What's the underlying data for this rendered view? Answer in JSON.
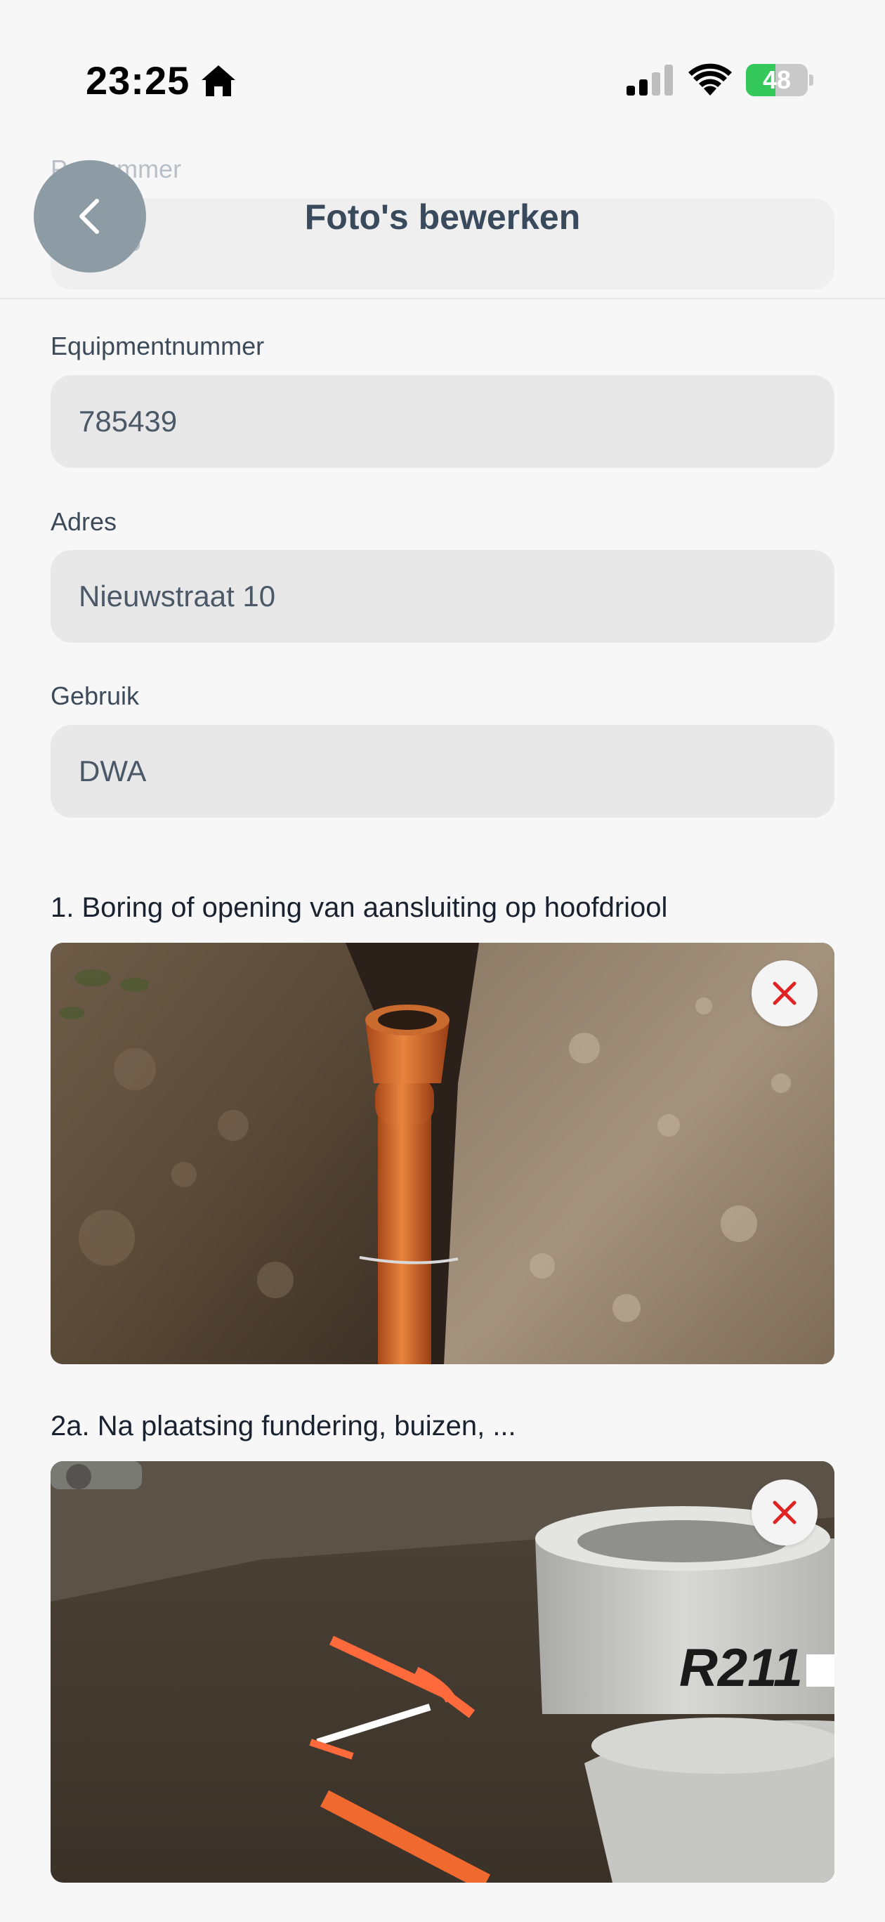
{
  "status_bar": {
    "time": "23:25",
    "battery": "48",
    "battery_level": 0.48,
    "icons": [
      "home-icon",
      "cellular-signal-icon",
      "wifi-icon",
      "battery-charging-icon"
    ]
  },
  "header": {
    "title": "Foto's bewerken",
    "ghost_label": "Putnummer",
    "ghost_value": "1075",
    "back_icon": "chevron-left-icon"
  },
  "form": {
    "equipment": {
      "label": "Equipmentnummer",
      "value": "785439"
    },
    "address": {
      "label": "Adres",
      "value": "Nieuwstraat 10"
    },
    "usage": {
      "label": "Gebruik",
      "value": "DWA"
    }
  },
  "photos": [
    {
      "label": "1. Boring of opening van aansluiting op hoofdriool",
      "remove_icon": "close-icon"
    },
    {
      "label": "2a. Na plaatsing fundering, buizen, ...",
      "remove_icon": "close-icon",
      "text_on_photo": "R211"
    }
  ],
  "colors": {
    "title": "#384a5c",
    "back_button": "#8d9ba4",
    "field_background": "#e8e8e8",
    "remove_icon": "#e02424",
    "battery_fill": "#34c759"
  }
}
